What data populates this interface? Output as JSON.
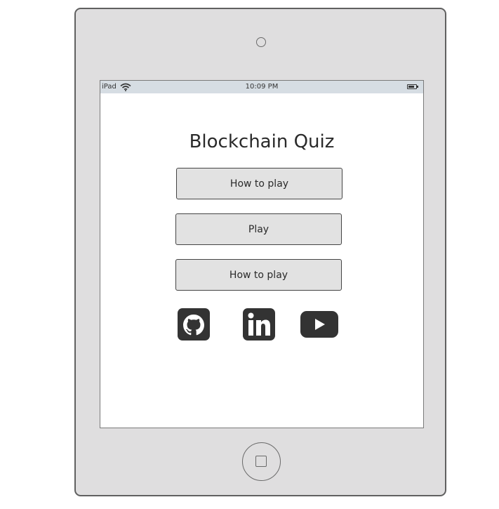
{
  "statusbar": {
    "device_label": "iPad",
    "time": "10:09 PM",
    "icons": [
      "wifi-icon",
      "battery-icon"
    ]
  },
  "app": {
    "title": "Blockchain Quiz"
  },
  "menu": {
    "buttons": [
      {
        "label": "How to play"
      },
      {
        "label": "Play"
      },
      {
        "label": "How to play"
      }
    ]
  },
  "social": {
    "icons": [
      "github-icon",
      "linkedin-icon",
      "youtube-icon"
    ]
  },
  "colors": {
    "device_frame": "#dfdedf",
    "status_bar": "#d6dde3",
    "button_fill": "#e2e2e2",
    "icon_fill": "#333333"
  }
}
